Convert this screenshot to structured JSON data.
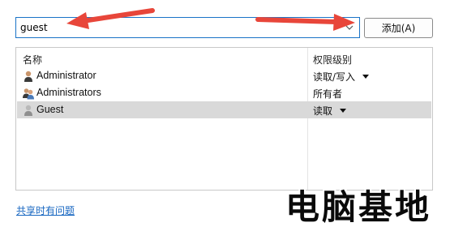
{
  "search": {
    "value": "guest",
    "placeholder": ""
  },
  "add_button": {
    "label": "添加(A)"
  },
  "list": {
    "columns": {
      "name": "名称",
      "permission": "权限级别"
    },
    "rows": [
      {
        "name": "Administrator",
        "permission": "读取/写入",
        "has_dropdown": true,
        "icon": "user-icon",
        "selected": false
      },
      {
        "name": "Administrators",
        "permission": "所有者",
        "has_dropdown": false,
        "icon": "group-icon",
        "selected": false
      },
      {
        "name": "Guest",
        "permission": "读取",
        "has_dropdown": true,
        "icon": "guest-user-icon",
        "selected": true
      }
    ]
  },
  "link": {
    "label": "共享时有问题"
  },
  "watermark": {
    "text": "电脑基地"
  },
  "colors": {
    "accent_border": "#1a73c7",
    "selected_row": "#d9d9d9",
    "link": "#1565c0",
    "annotation_arrow": "#e8463a"
  }
}
